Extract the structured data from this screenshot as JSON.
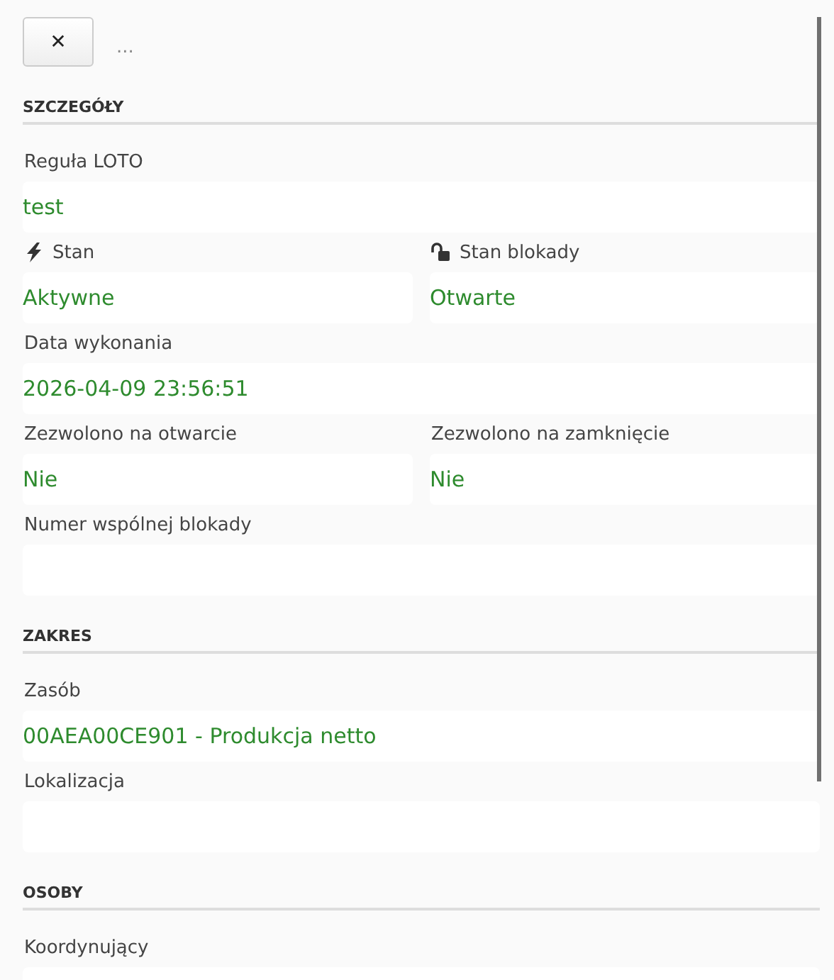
{
  "toolbar": {
    "close_button": "✕",
    "breadcrumb": "..."
  },
  "sections": [
    {
      "title": "SZCZEGÓŁY",
      "rows": [
        [
          {
            "label": "Reguła LOTO",
            "value": "test"
          }
        ],
        [
          {
            "label": "Stan",
            "value": "Aktywne",
            "kind": "power"
          },
          {
            "label": "Stan blokady",
            "value": "Otwarte",
            "kind": "lock"
          }
        ],
        [
          {
            "label": "Data wykonania",
            "value": "2026-04-09 23:56:51"
          }
        ],
        [
          {
            "label": "Zezwolono na otwarcie",
            "value": "Nie"
          },
          {
            "label": "Zezwolono na zamknięcie",
            "value": "Nie"
          }
        ],
        [
          {
            "label": "Numer wspólnej blokady"
          }
        ]
      ]
    },
    {
      "title": "ZAKRES",
      "rows": [
        [
          {
            "label": "Zasób",
            "value": "00AEA00CE901 - Produkcja netto"
          }
        ],
        [
          {
            "label": "Lokalizacja"
          }
        ]
      ]
    },
    {
      "title": "OSOBY",
      "rows": [
        [
          {
            "label": "Koordynujący"
          }
        ]
      ]
    }
  ]
}
